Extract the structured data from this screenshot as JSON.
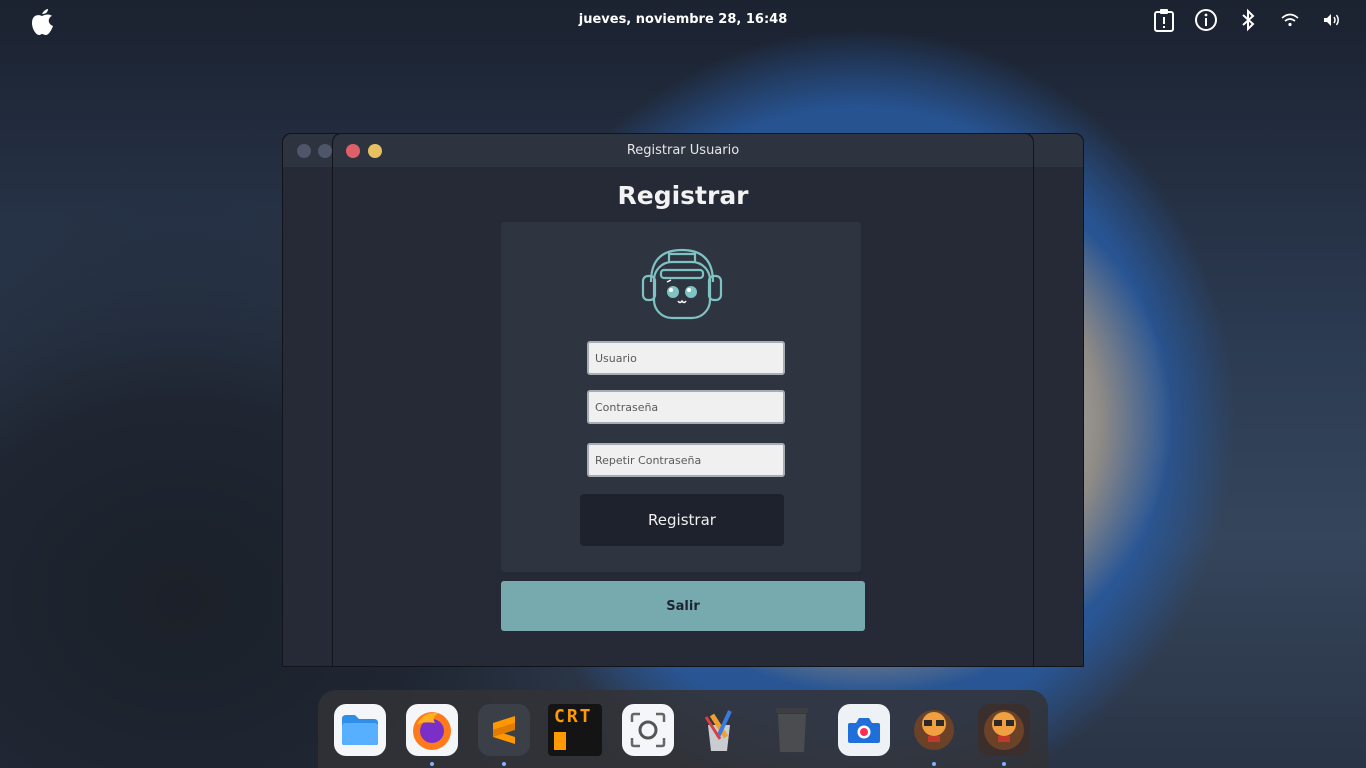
{
  "topbar": {
    "clock": "jueves, noviembre 28, 16:48",
    "tray_icons": [
      "clipboard-icon",
      "info-icon",
      "bluetooth-icon",
      "wifi-icon",
      "volume-icon"
    ]
  },
  "window": {
    "title": "Registrar Usuario",
    "heading": "Registrar",
    "form": {
      "username_placeholder": "Usuario",
      "password_placeholder": "Contraseña",
      "repeat_password_placeholder": "Repetir Contraseña",
      "register_label": "Registrar"
    },
    "exit_label": "Salir"
  },
  "dock": {
    "items": [
      "files",
      "firefox",
      "sublime-text",
      "cool-retro-term",
      "screenshot",
      "graphics-editor",
      "trash",
      "camera",
      "game-app",
      "game-app-2"
    ],
    "crt_label": "CRT"
  },
  "colors": {
    "accent": "#77aaaf",
    "window_bg": "#252a36",
    "card_bg": "#2f3441",
    "close": "#e0606a",
    "minimize": "#e8c060"
  }
}
